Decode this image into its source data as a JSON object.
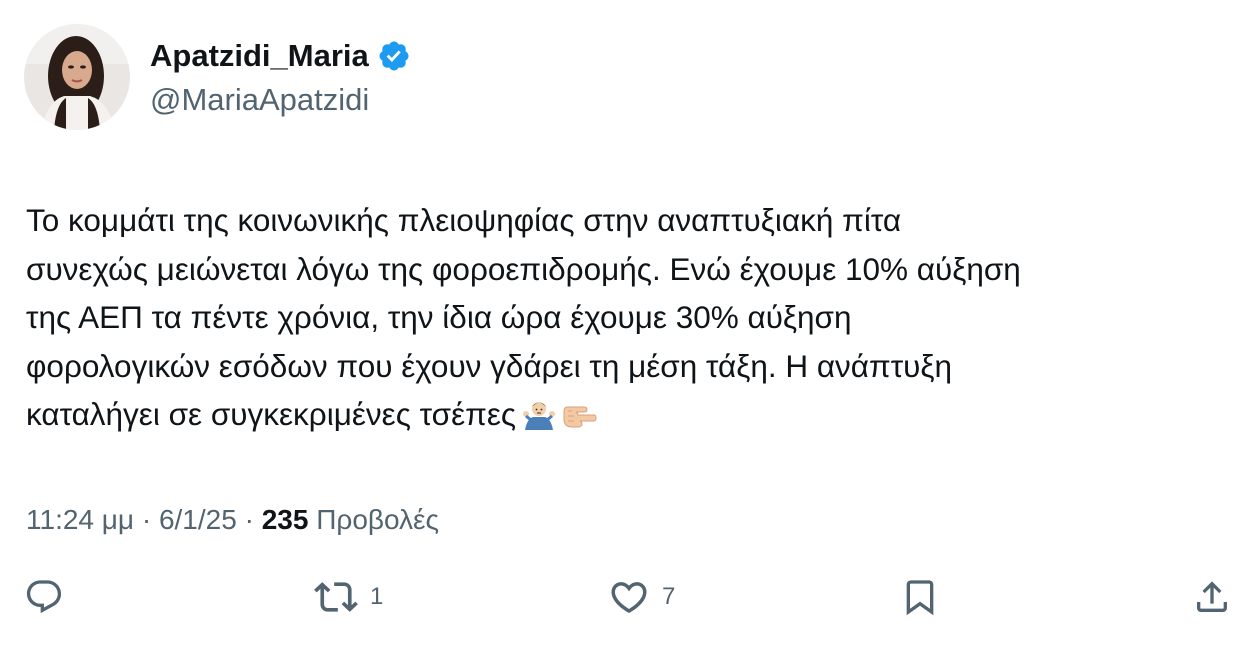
{
  "author": {
    "display_name": "Apatzidi_Maria",
    "handle": "@MariaApatzidi",
    "verified": true
  },
  "tweet": {
    "lines": [
      "Το κομμάτι της κοινωνικής πλειοψηφίας στην αναπτυξιακή πίτα",
      "συνεχώς μειώνεται λόγω της φοροεπιδρομής. Ενώ έχουμε 10% αύξηση",
      "της ΑΕΠ τα πέντε χρόνια, την ίδια ώρα έχουμε 30% αύξηση",
      "φορολογικών εσόδων που έχουν γδάρει τη μέση τάξη. Η ανάπτυξη",
      "καταλήγει σε συγκεκριμένες τσέπες"
    ],
    "emojis": [
      "man-shrugging-icon",
      "pointing-hand-icon"
    ]
  },
  "meta": {
    "time": "11:24 μμ",
    "separator": "·",
    "date": "6/1/25",
    "views_count": "235",
    "views_label": "Προβολές"
  },
  "actions": {
    "reply_count": "",
    "retweet_count": "1",
    "like_count": "7"
  },
  "colors": {
    "text": "#0f1419",
    "secondary": "#536471",
    "verified_blue": "#1d9bf0"
  }
}
